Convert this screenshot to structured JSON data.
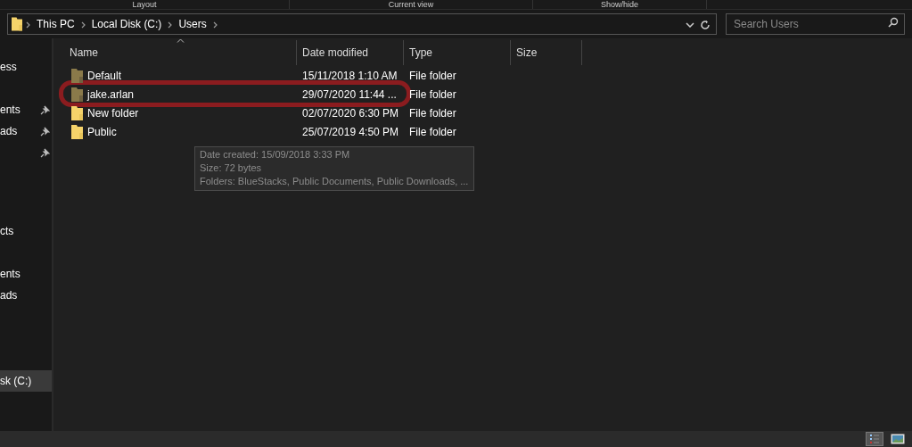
{
  "ribbon_groups": [
    "Layout",
    "Current view",
    "Show/hide"
  ],
  "address_bar": {
    "crumbs": [
      "This PC",
      "Local Disk (C:)",
      "Users"
    ]
  },
  "search": {
    "placeholder": "Search Users"
  },
  "sidebar": {
    "items": [
      {
        "label": "ess",
        "pinned": false,
        "selected": false
      },
      {
        "label": "ents",
        "pinned": true,
        "selected": false
      },
      {
        "label": "ads",
        "pinned": true,
        "selected": false
      },
      {
        "pinned": true,
        "selected": false
      },
      {
        "label": "cts",
        "pinned": false,
        "selected": false
      },
      {
        "label": "ents",
        "pinned": false,
        "selected": false
      },
      {
        "label": "ads",
        "pinned": false,
        "selected": false
      },
      {
        "label": "sk (C:)",
        "pinned": false,
        "selected": true
      }
    ]
  },
  "table": {
    "columns": [
      "Name",
      "Date modified",
      "Type",
      "Size"
    ],
    "rows": [
      {
        "name": "Default",
        "date": "15/11/2018 1:10 AM",
        "type": "File folder",
        "hidden": true,
        "highlighted": false
      },
      {
        "name": "jake.arlan",
        "date": "29/07/2020 11:44 ...",
        "type": "File folder",
        "hidden": true,
        "highlighted": true
      },
      {
        "name": "New folder",
        "date": "02/07/2020 6:30 PM",
        "type": "File folder",
        "hidden": false,
        "highlighted": false
      },
      {
        "name": "Public",
        "date": "25/07/2019 4:50 PM",
        "type": "File folder",
        "hidden": false,
        "highlighted": false
      }
    ]
  },
  "tooltip": [
    "Date created: 15/09/2018 3:33 PM",
    "Size: 72 bytes",
    "Folders: BlueStacks, Public Documents, Public Downloads, ..."
  ],
  "status_bar": {
    "views": [
      {
        "kind": "details",
        "selected": true
      },
      {
        "kind": "thumbnails",
        "selected": false
      }
    ]
  }
}
